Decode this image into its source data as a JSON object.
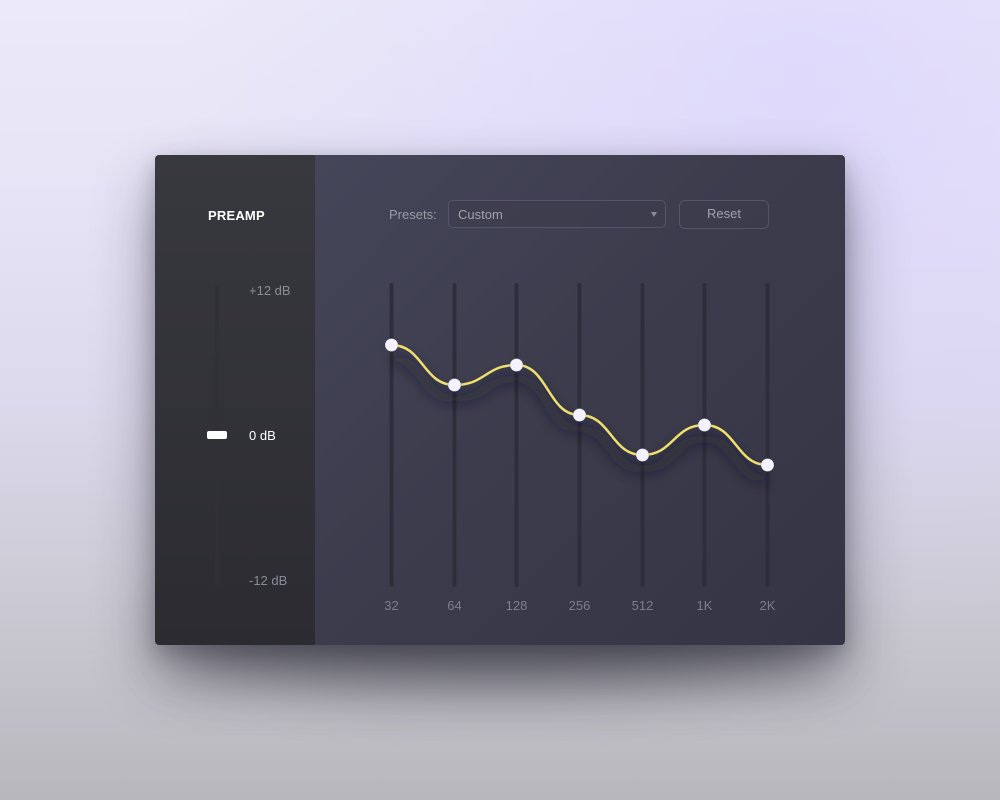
{
  "preamp": {
    "title": "PREAMP",
    "scale_top": "+12 dB",
    "scale_mid": "0 dB",
    "scale_bottom": "-12 dB",
    "gain_db": 0
  },
  "presets": {
    "label": "Presets:",
    "selected": "Custom",
    "chevron_icon": "chevron-down-icon"
  },
  "reset_label": "Reset",
  "eq": {
    "range_db": [
      -12,
      12
    ],
    "curve_color": "#efe06e",
    "fill_color": "#8c7cf4",
    "bands": [
      {
        "freq": "32",
        "gain_db": 7.2
      },
      {
        "freq": "64",
        "gain_db": 4.0
      },
      {
        "freq": "128",
        "gain_db": 5.6
      },
      {
        "freq": "256",
        "gain_db": 1.6
      },
      {
        "freq": "512",
        "gain_db": -1.6
      },
      {
        "freq": "1K",
        "gain_db": 0.8
      },
      {
        "freq": "2K",
        "gain_db": -2.4
      }
    ]
  }
}
